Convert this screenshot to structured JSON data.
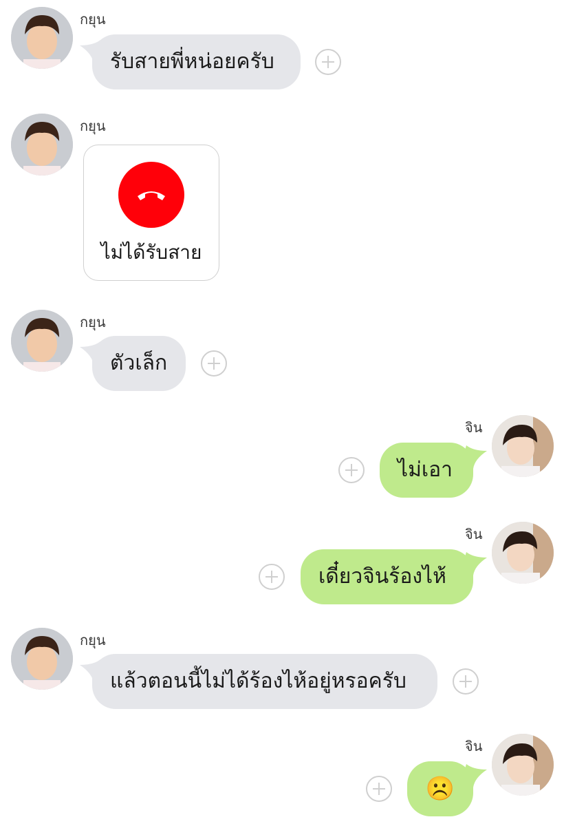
{
  "contacts": {
    "kayoon": "กยุน",
    "jin": "จิน"
  },
  "messages": [
    {
      "side": "in",
      "type": "text",
      "sender": "กยุน",
      "text": "รับสายพี่หน่อยครับ"
    },
    {
      "side": "in",
      "type": "call",
      "sender": "กยุน",
      "call_status": "ไม่ได้รับสาย"
    },
    {
      "side": "in",
      "type": "text",
      "sender": "กยุน",
      "text": "ตัวเล็ก"
    },
    {
      "side": "out",
      "type": "text",
      "sender": "จิน",
      "text": "ไม่เอา"
    },
    {
      "side": "out",
      "type": "text",
      "sender": "จิน",
      "text": "เดี๋ยวจินร้องไห้"
    },
    {
      "side": "in",
      "type": "text",
      "sender": "กยุน",
      "text": "แล้วตอนนี้ไม่ได้ร้องไห้อยู่หรอครับ"
    },
    {
      "side": "out",
      "type": "emoji",
      "sender": "จิน",
      "text": "☹️"
    }
  ],
  "colors": {
    "incoming_bubble": "#e5e6ea",
    "outgoing_bubble": "#bfea8c",
    "missed_call": "#ff0009"
  },
  "icons": {
    "add": "plus-circle-icon",
    "missed_call": "phone-hangup-icon"
  }
}
